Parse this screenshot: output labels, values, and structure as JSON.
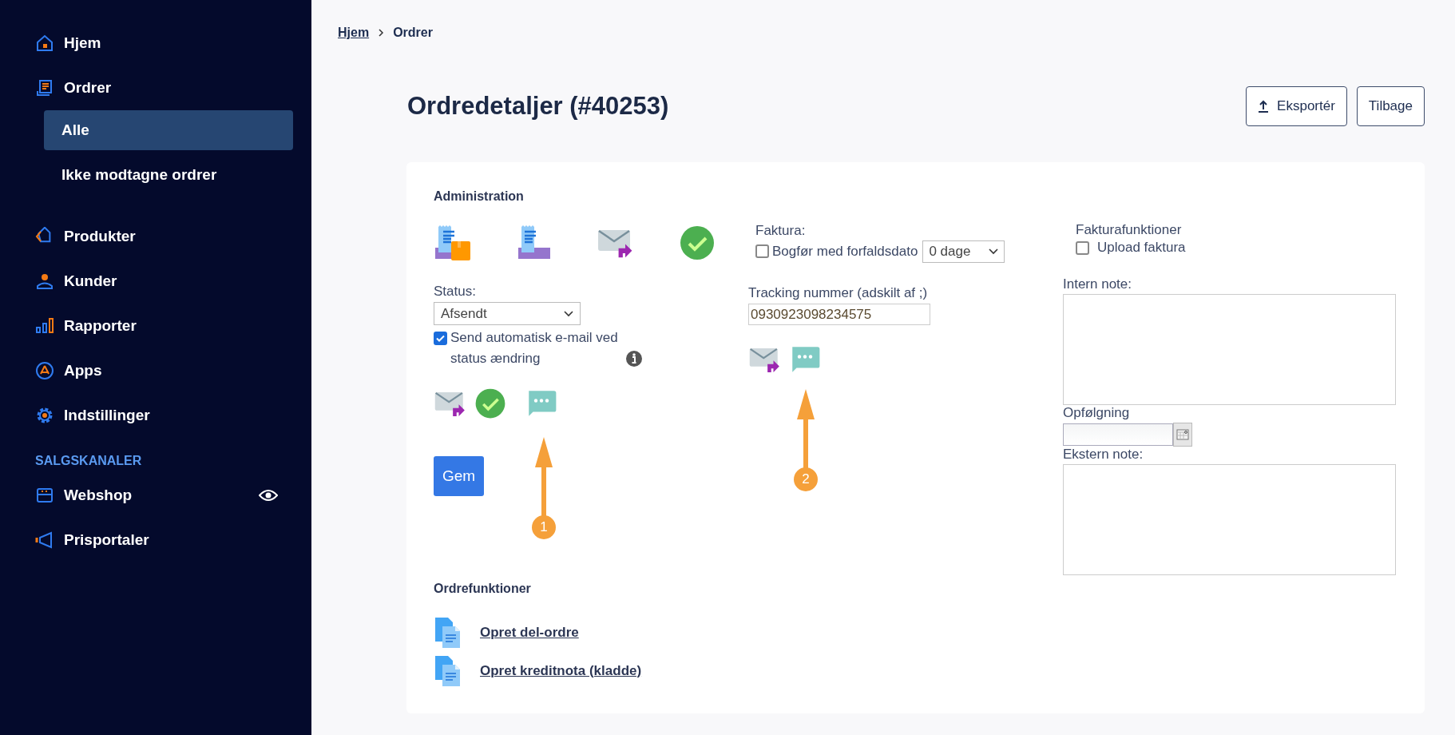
{
  "sidebar": {
    "items": [
      {
        "label": "Hjem",
        "kind": "home"
      },
      {
        "label": "Ordrer",
        "kind": "orders",
        "children": [
          {
            "label": "Alle",
            "selected": true
          },
          {
            "label": "Ikke modtagne ordrer",
            "selected": false
          }
        ]
      },
      {
        "label": "Produkter",
        "kind": "tag"
      },
      {
        "label": "Kunder",
        "kind": "person"
      },
      {
        "label": "Rapporter",
        "kind": "chart"
      },
      {
        "label": "Apps",
        "kind": "apps"
      },
      {
        "label": "Indstillinger",
        "kind": "gear"
      }
    ],
    "section_title": "SALGSKANALER",
    "channels": [
      {
        "label": "Webshop",
        "kind": "store"
      },
      {
        "label": "Prisportaler",
        "kind": "megaphone"
      }
    ]
  },
  "breadcrumb": [
    {
      "label": "Hjem",
      "kind": "link"
    },
    {
      "label": "Ordrer",
      "kind": "current"
    }
  ],
  "header": {
    "title": "Ordredetaljer (#40253)",
    "buttons": [
      {
        "label": "Eksportér",
        "kind": "export"
      },
      {
        "label": "Tilbage",
        "kind": "plain"
      }
    ]
  },
  "administration": {
    "title": "Administration",
    "status": {
      "label": "Status:",
      "value": "Afsendt"
    },
    "auto_email": {
      "label": "Send automatisk e-mail ved status ændring",
      "checked": true
    },
    "save_button": "Gem",
    "invoice": {
      "label": "Faktura:",
      "book": {
        "label": "Bogfør med forfaldsdato",
        "checked": false
      },
      "due": "0 dage"
    },
    "tracking": {
      "label": "Tracking nummer (adskilt af ;)",
      "value": "0930923098234575"
    },
    "invoice_functions": {
      "title": "Fakturafunktioner",
      "upload": {
        "label": "Upload faktura",
        "checked": false
      }
    },
    "internal_note": {
      "label": "Intern note:"
    },
    "follow_up": {
      "label": "Opfølgning"
    },
    "external_note": {
      "label": "Ekstern note:"
    }
  },
  "order_functions": {
    "title": "Ordrefunktioner",
    "links": [
      "Opret del-ordre",
      "Opret kreditnota (kladde)"
    ]
  },
  "annotations": [
    {
      "label": "1"
    },
    {
      "label": "2"
    }
  ]
}
